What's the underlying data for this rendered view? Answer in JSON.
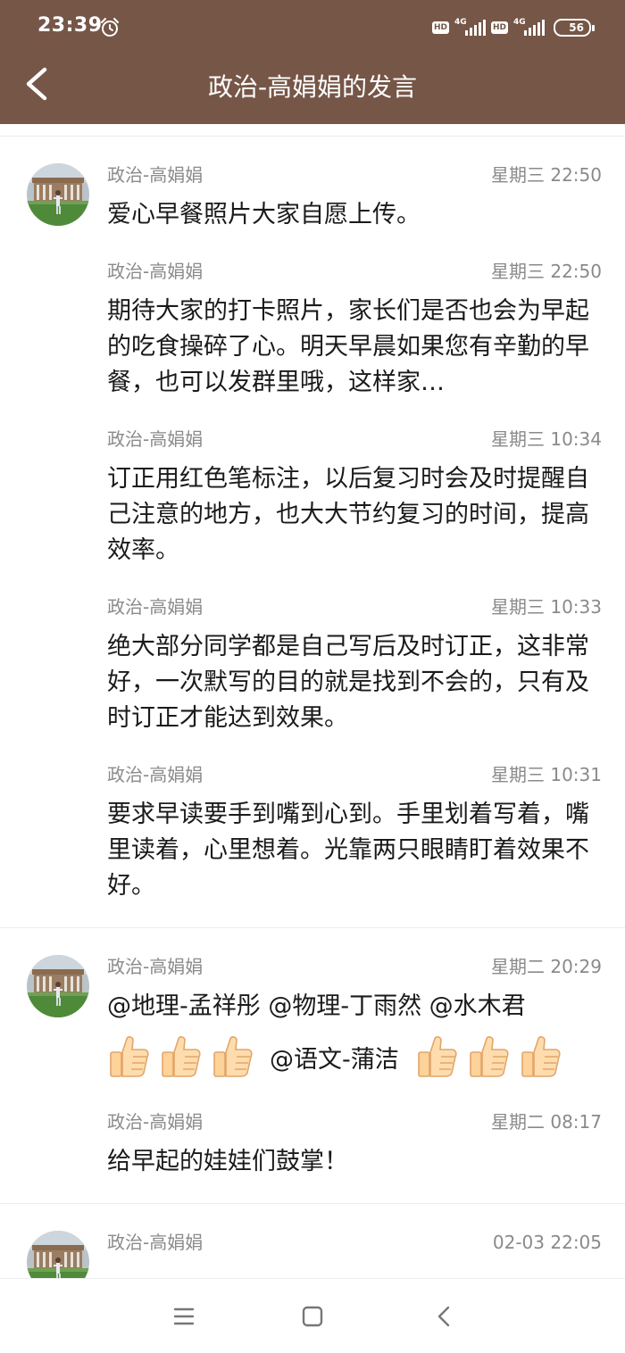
{
  "status": {
    "time": "23:39",
    "hd1": "HD",
    "hd2": "HD",
    "net1": "4G",
    "net2": "4G",
    "battery": "56"
  },
  "header": {
    "title": "政治-高娟娟的发言"
  },
  "groups": [
    {
      "messages": [
        {
          "author": "政治-高娟娟",
          "time": "星期三 22:50",
          "text": "爱心早餐照片大家自愿上传。"
        },
        {
          "author": "政治-高娟娟",
          "time": "星期三 22:50",
          "text": "期待大家的打卡照片，家长们是否也会为早起的吃食操碎了心。明天早晨如果您有辛勤的早餐，也可以发群里哦，这样家…"
        },
        {
          "author": "政治-高娟娟",
          "time": "星期三 10:34",
          "text": "订正用红色笔标注，以后复习时会及时提醒自己注意的地方，也大大节约复习的时间，提高效率。"
        },
        {
          "author": "政治-高娟娟",
          "time": "星期三 10:33",
          "text": "绝大部分同学都是自己写后及时订正，这非常好，一次默写的目的就是找到不会的，只有及时订正才能达到效果。"
        },
        {
          "author": "政治-高娟娟",
          "time": "星期三 10:31",
          "text": "要求早读要手到嘴到心到。手里划着写着，嘴里读着，心里想着。光靠两只眼睛盯着效果不好。"
        }
      ]
    },
    {
      "messages": [
        {
          "author": "政治-高娟娟",
          "time": "星期二 20:29",
          "text": "@地理-孟祥彤 @物理-丁雨然 @水木君",
          "mention": "@语文-蒲洁"
        },
        {
          "author": "政治-高娟娟",
          "time": "星期二 08:17",
          "text": "给早起的娃娃们鼓掌！"
        }
      ]
    },
    {
      "messages": [
        {
          "author": "政治-高娟娟",
          "time": "02-03 22:05"
        }
      ]
    }
  ],
  "icons": {
    "back": "chevron-left-icon",
    "thumb": "thumbs-up-emoji",
    "menu": "menu-icon",
    "home": "home-square-icon",
    "nav_back": "back-triangle-icon"
  },
  "colors": {
    "header_bg": "#765647",
    "meta_text": "#8a8a8a",
    "body_text": "#1a1a1a"
  }
}
